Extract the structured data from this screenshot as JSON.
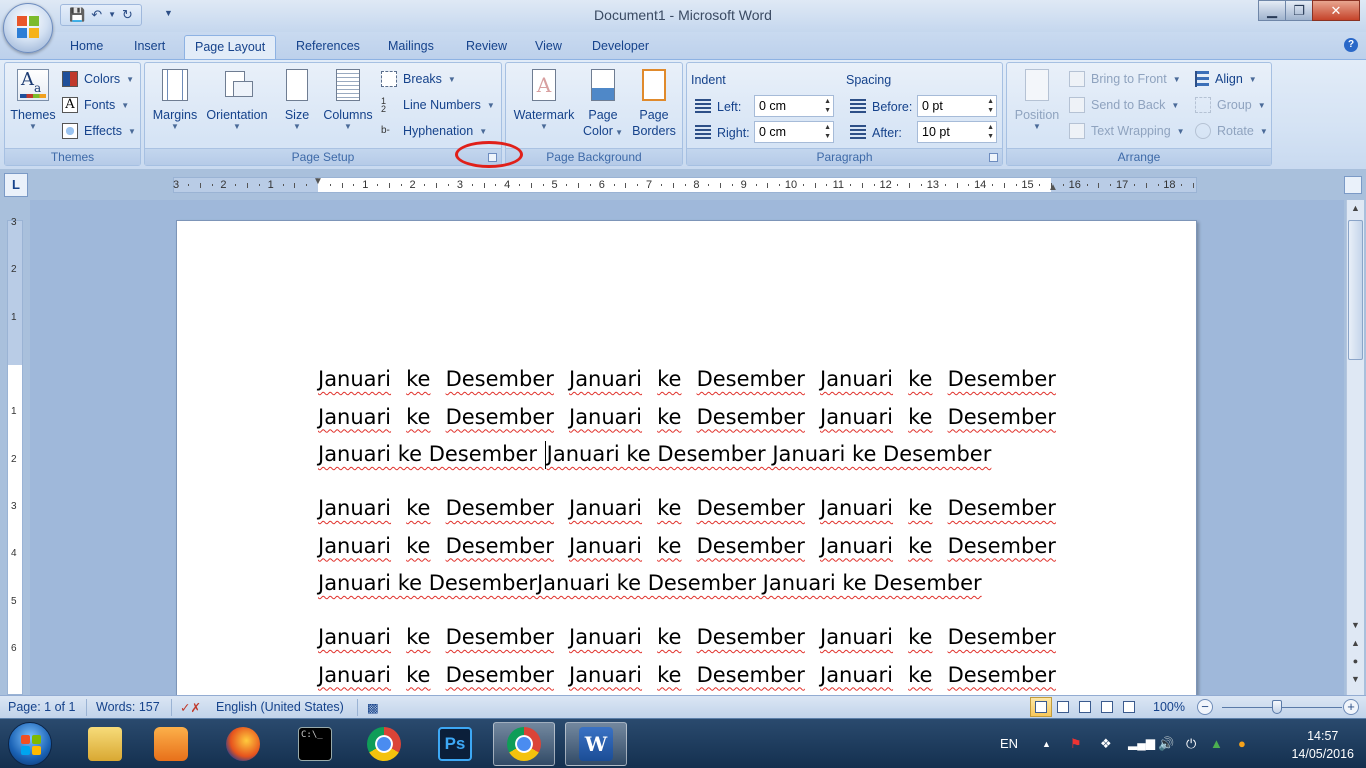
{
  "window": {
    "title": "Document1 - Microsoft Word",
    "minimize": "▁",
    "maximize": "❐",
    "close": "✕"
  },
  "tabs": [
    "Home",
    "Insert",
    "Page Layout",
    "References",
    "Mailings",
    "Review",
    "View",
    "Developer"
  ],
  "help": "?",
  "ribbon": {
    "themes": {
      "label": "Themes",
      "themes_button": "Themes",
      "colors": "Colors",
      "fonts": "Fonts",
      "effects": "Effects"
    },
    "page_setup": {
      "label": "Page Setup",
      "margins": "Margins",
      "orientation": "Orientation",
      "size": "Size",
      "columns": "Columns",
      "breaks": "Breaks",
      "line_numbers": "Line Numbers",
      "hyphenation": "Hyphenation"
    },
    "page_background": {
      "label": "Page Background",
      "watermark": "Watermark",
      "page_color_1": "Page",
      "page_color_2": "Color",
      "page_borders_1": "Page",
      "page_borders_2": "Borders"
    },
    "paragraph": {
      "label": "Paragraph",
      "indent": "Indent",
      "spacing": "Spacing",
      "left_label": "Left:",
      "left_value": "0 cm",
      "right_label": "Right:",
      "right_value": "0 cm",
      "before_label": "Before:",
      "before_value": "0 pt",
      "after_label": "After:",
      "after_value": "10 pt"
    },
    "arrange": {
      "label": "Arrange",
      "position": "Position",
      "bring_to_front": "Bring to Front",
      "send_to_back": "Send to Back",
      "text_wrapping": "Text Wrapping",
      "align": "Align",
      "group": "Group",
      "rotate": "Rotate"
    }
  },
  "ruler": {
    "tab_selector": "L",
    "horizontal_ticks": [
      "3",
      "2",
      "1",
      "1",
      "2",
      "3",
      "4",
      "5",
      "6",
      "7",
      "8",
      "9",
      "10",
      "11",
      "12",
      "13",
      "14",
      "15",
      "16",
      "17",
      "18"
    ],
    "vertical_ticks": [
      "3",
      "2",
      "1",
      "1",
      "2",
      "3",
      "4",
      "5",
      "6"
    ]
  },
  "document": {
    "paragraphs": [
      {
        "lines": [
          [
            "Januari",
            "ke",
            "Desember",
            "Januari",
            "ke",
            "Desember",
            "Januari",
            "ke",
            "Desember"
          ],
          [
            "Januari",
            "ke",
            "Desember",
            "Januari",
            "ke",
            "Desember",
            "Januari",
            "ke",
            "Desember"
          ]
        ],
        "last_line_a": "Januari ke Desember ",
        "last_line_b": "Januari ke Desember Januari ke Desember"
      },
      {
        "lines": [
          [
            "Januari",
            "ke",
            "Desember",
            "Januari",
            "ke",
            "Desember",
            "Januari",
            "ke",
            "Desember"
          ],
          [
            "Januari",
            "ke",
            "Desember",
            "Januari",
            "ke",
            "Desember",
            "Januari",
            "ke",
            "Desember"
          ]
        ],
        "last_line": "Januari ke DesemberJanuari ke Desember Januari ke Desember"
      },
      {
        "lines": [
          [
            "Januari",
            "ke",
            "Desember",
            "Januari",
            "ke",
            "Desember",
            "Januari",
            "ke",
            "Desember"
          ],
          [
            "Januari",
            "ke",
            "Desember",
            "Januari",
            "ke",
            "Desember",
            "Januari",
            "ke",
            "Desember"
          ]
        ]
      }
    ]
  },
  "statusbar": {
    "page": "Page: 1 of 1",
    "words": "Words: 157",
    "language": "English (United States)",
    "zoom": "100%",
    "zoom_minus": "−",
    "zoom_plus": "+"
  },
  "taskbar": {
    "apps": [
      "file-explorer",
      "media-player",
      "firefox",
      "command-prompt",
      "chrome",
      "photoshop",
      "chrome",
      "word"
    ],
    "photoshop_label": "Ps",
    "cmd_label": "C:\\_",
    "language": "EN",
    "time": "14:57",
    "date": "14/05/2016"
  }
}
